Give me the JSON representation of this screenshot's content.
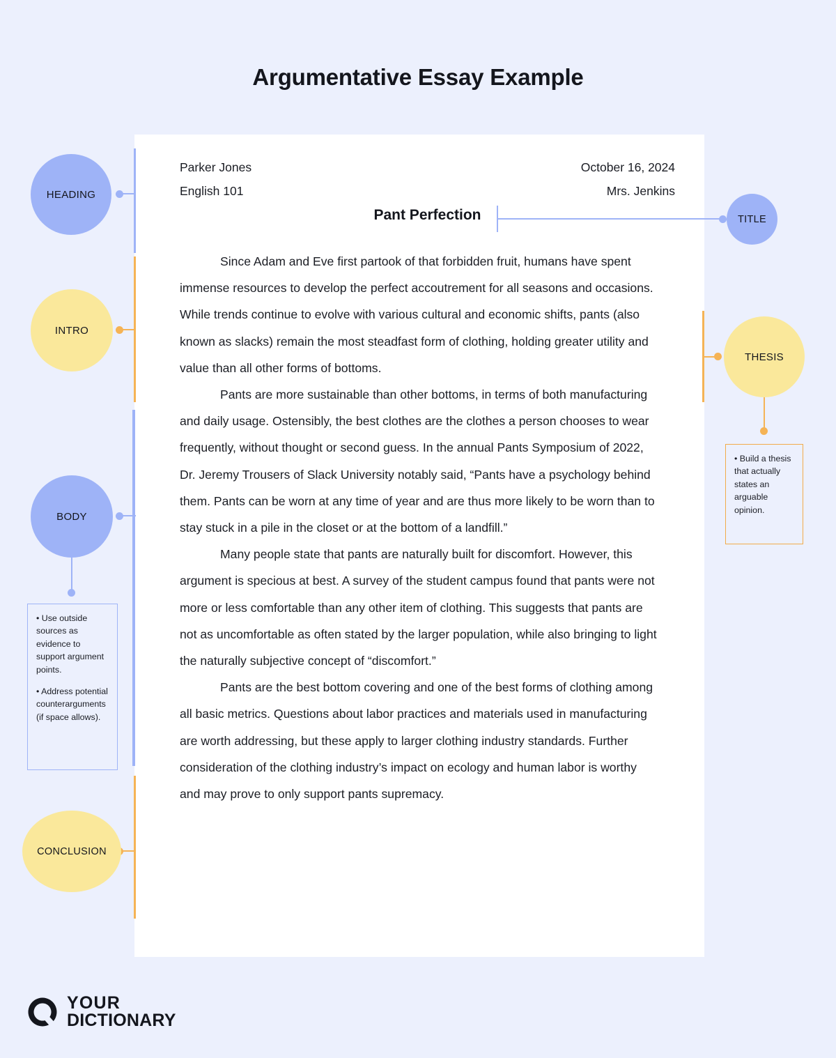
{
  "page": {
    "title": "Argumentative Essay Example",
    "background_color": "#ecf0fd",
    "accent_blue": "#9eb3f7",
    "accent_yellow": "#fae89b",
    "accent_orange": "#f5b355"
  },
  "document": {
    "header_left": {
      "student_name": "Parker Jones",
      "course": "English 101"
    },
    "header_right": {
      "date": "October 16, 2024",
      "instructor": "Mrs. Jenkins"
    },
    "title": "Pant Perfection",
    "paragraphs": [
      "Since Adam and Eve first partook of that forbidden fruit, humans have spent immense resources to develop the perfect accoutrement for all seasons and occasions. While trends continue to evolve with various cultural and economic shifts, pants (also known as slacks) remain the most steadfast form of clothing, holding greater utility and value than all other forms of bottoms.",
      "Pants are more sustainable than other bottoms, in terms of both manufacturing and daily usage. Ostensibly, the best clothes are the clothes a person chooses to wear frequently, without thought or second guess. In the annual Pants Symposium of 2022, Dr. Jeremy Trousers of Slack University notably said, “Pants have a psychology behind them. Pants can be worn at any time of year and are thus more likely to be worn than to stay stuck in a pile in the closet or at the bottom of a landfill.”",
      "Many people state that pants are naturally built for discomfort. However, this argument is specious at best. A survey of the student campus found that pants were not more or less comfortable than any other item of clothing. This suggests that pants are not as uncomfortable as often stated by the larger population, while also bringing to light the naturally subjective concept of “discomfort.”",
      "Pants are the best bottom covering and one of the best forms of clothing among all basic metrics. Questions about labor practices and materials used in manufacturing are worth addressing, but these apply to larger clothing industry standards. Further consideration of the clothing industry’s impact on ecology and human labor is worthy and may prove to only support pants supremacy."
    ]
  },
  "annotations": {
    "heading": {
      "label": "HEADING",
      "color": "#9eb3f7"
    },
    "intro": {
      "label": "INTRO",
      "color": "#fae89b"
    },
    "body": {
      "label": "BODY",
      "color": "#9eb3f7"
    },
    "conclusion": {
      "label": "CONCLUSION",
      "color": "#fae89b"
    },
    "title": {
      "label": "TITLE",
      "color": "#9eb3f7"
    },
    "thesis": {
      "label": "THESIS",
      "color": "#fae89b"
    }
  },
  "tips": {
    "body": {
      "items": [
        "• Use outside sources as evidence to support argument points.",
        "• Address potential counterarguments (if space allows)."
      ]
    },
    "thesis": {
      "items": [
        "• Build a thesis that actually states an arguable opinion."
      ]
    }
  },
  "logo": {
    "line1": "YOUR",
    "line2": "DICTIONARY"
  }
}
